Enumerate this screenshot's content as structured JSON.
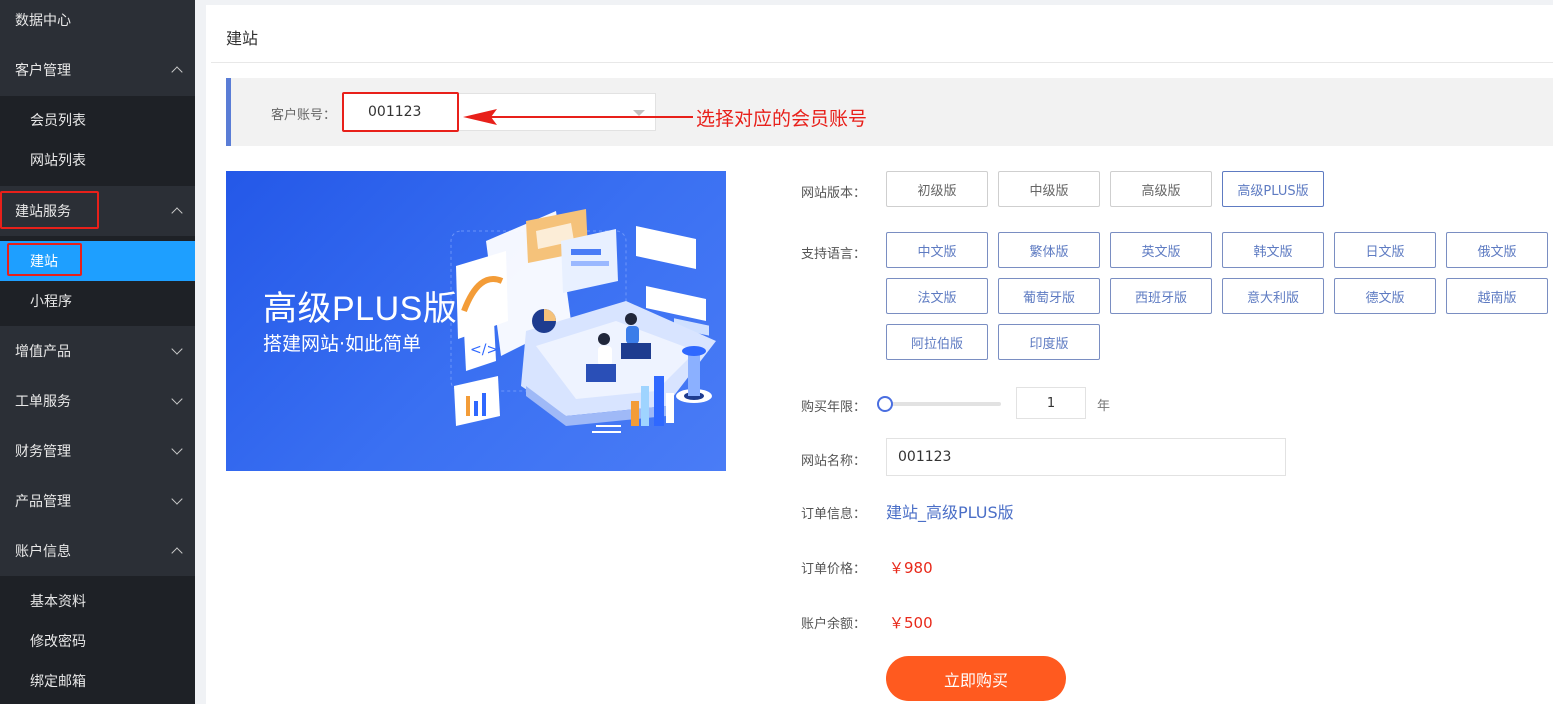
{
  "sidebar": {
    "items": [
      {
        "label": "数据中心"
      },
      {
        "label": "客户管理",
        "sub": [
          {
            "label": "会员列表"
          },
          {
            "label": "网站列表"
          }
        ]
      },
      {
        "label": "建站服务",
        "sub": [
          {
            "label": "建站"
          },
          {
            "label": "小程序"
          }
        ]
      },
      {
        "label": "增值产品"
      },
      {
        "label": "工单服务"
      },
      {
        "label": "财务管理"
      },
      {
        "label": "产品管理"
      },
      {
        "label": "账户信息",
        "sub": [
          {
            "label": "基本资料"
          },
          {
            "label": "修改密码"
          },
          {
            "label": "绑定邮箱"
          }
        ]
      }
    ],
    "active_item": "建站",
    "highlight_color": "#1e9fff"
  },
  "page": {
    "title": "建站",
    "account_label": "客户账号：",
    "account_value": "001123",
    "annotation": "选择对应的会员账号"
  },
  "banner": {
    "title": "高级PLUS版",
    "subtitle": "搭建网站·如此简单"
  },
  "form": {
    "version_label": "网站版本：",
    "versions": [
      {
        "label": "初级版"
      },
      {
        "label": "中级版"
      },
      {
        "label": "高级版"
      },
      {
        "label": "高级PLUS版"
      }
    ],
    "selected_version": "高级PLUS版",
    "language_label": "支持语言：",
    "languages": [
      {
        "label": "中文版"
      },
      {
        "label": "繁体版"
      },
      {
        "label": "英文版"
      },
      {
        "label": "韩文版"
      },
      {
        "label": "日文版"
      },
      {
        "label": "俄文版"
      },
      {
        "label": "法文版"
      },
      {
        "label": "葡萄牙版"
      },
      {
        "label": "西班牙版"
      },
      {
        "label": "意大利版"
      },
      {
        "label": "德文版"
      },
      {
        "label": "越南版"
      },
      {
        "label": "阿拉伯版"
      },
      {
        "label": "印度版"
      }
    ],
    "years_label": "购买年限：",
    "years_value": "1",
    "years_unit": "年",
    "years_slider_fraction": 0,
    "site_name_label": "网站名称：",
    "site_name_value": "001123",
    "order_info_label": "订单信息：",
    "order_info_value": "建站_高级PLUS版",
    "order_price_label": "订单价格：",
    "order_price_value": "￥980",
    "balance_label": "账户余额：",
    "balance_value": "￥500",
    "buy_button": "立即购买",
    "accent_color": "#ff5a1f"
  }
}
